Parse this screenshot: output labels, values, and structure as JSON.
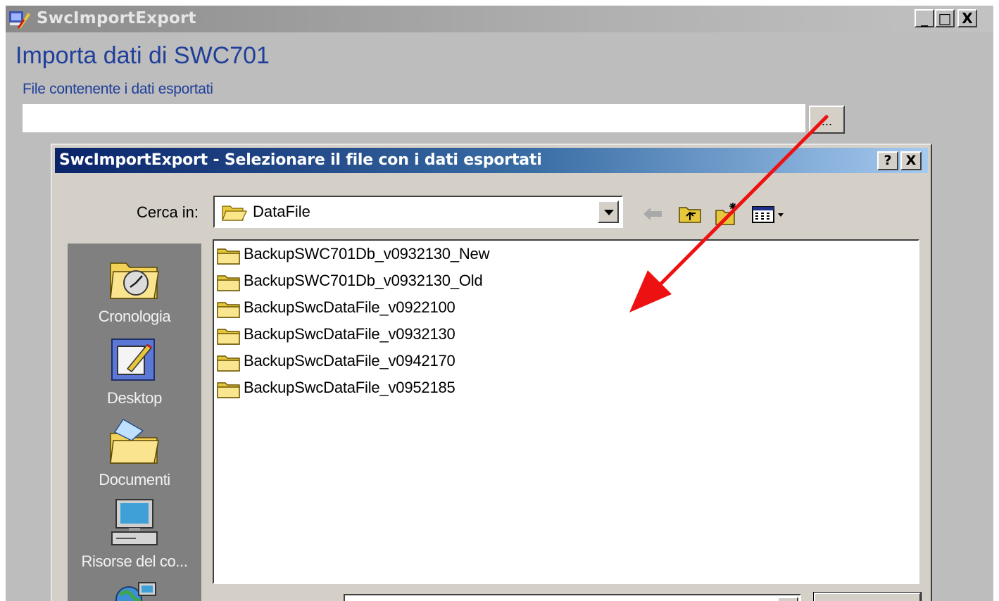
{
  "window": {
    "title": "SwcImportExport",
    "minimize_glyph": "_",
    "maximize_glyph": "□",
    "close_glyph": "X"
  },
  "main": {
    "heading": "Importa dati di SWC701",
    "file_label": "File contenente i dati esportati",
    "file_value": "",
    "browse_label": "..."
  },
  "dialog": {
    "title": "SwcImportExport - Selezionare il file con i dati esportati",
    "help_glyph": "?",
    "close_glyph": "X",
    "lookin_label": "Cerca in:",
    "lookin_value": "DataFile",
    "toolbar_icons": [
      "back-arrow-icon",
      "up-folder-icon",
      "new-folder-icon",
      "view-menu-icon"
    ],
    "places": [
      {
        "label": "Cronologia",
        "icon": "history-icon"
      },
      {
        "label": "Desktop",
        "icon": "desktop-icon"
      },
      {
        "label": "Documenti",
        "icon": "documents-icon"
      },
      {
        "label": "Risorse del co...",
        "icon": "my-computer-icon"
      }
    ],
    "files": [
      "BackupSWC701Db_v0932130_New",
      "BackupSWC701Db_v0932130_Old",
      "BackupSwcDataFile_v0922100",
      "BackupSwcDataFile_v0932130",
      "BackupSwcDataFile_v0942170",
      "BackupSwcDataFile_v0952185"
    ]
  },
  "colors": {
    "annotation_arrow": "#ee1111",
    "dialog_title_start": "#0a246a",
    "heading_text": "#1f3f9a"
  }
}
